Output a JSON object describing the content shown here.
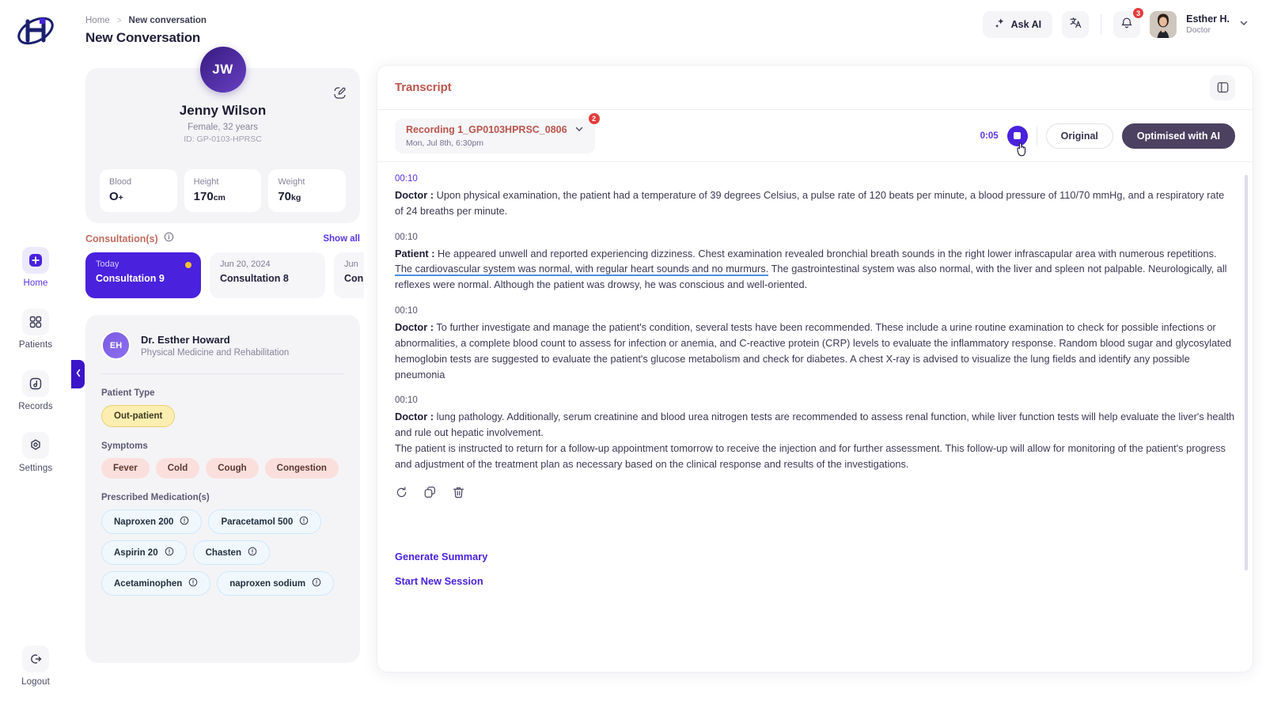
{
  "app": {
    "logo_alt": "H logo"
  },
  "breadcrumb": {
    "home": "Home",
    "separator": ">",
    "current": "New conversation"
  },
  "page_title": "New Conversation",
  "header": {
    "ask_ai": "Ask AI",
    "translate_icon": "translate-icon",
    "notification_count": "3",
    "user_name": "Esther H.",
    "user_role": "Doctor"
  },
  "sidebar": {
    "items": [
      {
        "label": "Home",
        "icon": "plus-square-icon",
        "active": true
      },
      {
        "label": "Patients",
        "icon": "grid-icon",
        "active": false
      },
      {
        "label": "Records",
        "icon": "note-icon",
        "active": false
      },
      {
        "label": "Settings",
        "icon": "gear-hex-icon",
        "active": false
      }
    ],
    "logout": "Logout"
  },
  "patient": {
    "initials": "JW",
    "name": "Jenny Wilson",
    "sub": "Female, 32 years",
    "id": "ID: GP-0103-HPRSC",
    "vitals": [
      {
        "key": "Blood",
        "value": "O",
        "unit": "+"
      },
      {
        "key": "Height",
        "value": "170",
        "unit": "cm"
      },
      {
        "key": "Weight",
        "value": "70",
        "unit": "kg"
      }
    ]
  },
  "consultations": {
    "title": "Consultation(s)",
    "show_all": "Show all",
    "cards": [
      {
        "date": "Today",
        "name": "Consultation 9",
        "selected": true
      },
      {
        "date": "Jun 20, 2024",
        "name": "Consultation 8",
        "selected": false
      },
      {
        "date": "Jun",
        "name": "Con",
        "selected": false
      }
    ]
  },
  "doctor": {
    "initials": "EH",
    "name": "Dr. Esther Howard",
    "specialty": "Physical Medicine and Rehabilitation"
  },
  "patient_type": {
    "label": "Patient Type",
    "value": "Out-patient"
  },
  "symptoms": {
    "label": "Symptoms",
    "items": [
      "Fever",
      "Cold",
      "Cough",
      "Congestion"
    ]
  },
  "medications": {
    "label": "Prescribed Medication(s)",
    "items": [
      "Naproxen 200",
      "Paracetamol 500",
      "Aspirin 20",
      "Chasten",
      "Acetaminophen",
      "naproxen sodium"
    ]
  },
  "transcript": {
    "title": "Transcript",
    "panel_toggle_icon": "panel-layout-icon",
    "recording_name": "Recording 1_GP0103HPRSC_0806",
    "recording_date": "Mon, Jul 8th, 6:30pm",
    "recording_badge": "2",
    "timecode": "0:05",
    "stop_icon": "stop-icon",
    "view_original": "Original",
    "view_optimised": "Optimised with AI",
    "active_view": "Optimised with AI",
    "entries": [
      {
        "time": "00:10",
        "speaker": "Doctor :",
        "text": "Upon physical examination, the patient had a temperature of 39 degrees Celsius, a pulse rate of 120 beats per minute, a blood pressure of 110/70 mmHg, and a respiratory rate of 24 breaths per minute."
      },
      {
        "time": "00:10",
        "speaker": "Patient :",
        "text_before": "He appeared unwell and reported experiencing dizziness. Chest examination revealed bronchial breath sounds in the right lower infrascapular area with numerous repetitions. ",
        "text_underlined": "The cardiovascular system was normal, with regular heart sounds and no murmurs.",
        "text_after": " The gastrointestinal system was also normal, with the liver and spleen not palpable. Neurologically, all reflexes were normal. Although the patient was drowsy, he was conscious and well-oriented."
      },
      {
        "time": "00:10",
        "speaker": "Doctor :",
        "text": "To further investigate and manage the patient's condition, several tests have been recommended. These include a urine routine examination to check for possible infections or abnormalities, a complete blood count to assess for infection or anemia, and C-reactive protein (CRP) levels to evaluate the inflammatory response. Random blood sugar and glycosylated hemoglobin tests are suggested to evaluate the patient's glucose metabolism and check for diabetes. A chest X-ray is advised to visualize the lung fields and identify any possible pneumonia"
      },
      {
        "time": "00:10",
        "speaker": "Doctor :",
        "text": "lung pathology. Additionally, serum creatinine and blood urea nitrogen tests are recommended to assess renal function, while liver function tests will help evaluate the liver's health and rule out hepatic involvement.",
        "text2": "The patient is instructed to return for a follow-up appointment tomorrow to receive the injection and for further assessment. This follow-up will allow for monitoring of the patient's progress and adjustment of the treatment plan as necessary based on the clinical response and results of the investigations."
      }
    ],
    "tools": [
      "regenerate-icon",
      "copy-icon",
      "delete-icon"
    ],
    "generate_summary": "Generate Summary",
    "start_new_session": "Start New Session"
  },
  "colors": {
    "accent_purple": "#4a21dd",
    "accent_link": "#5b34e0",
    "title_red": "#b9554a",
    "badge_red": "#e23d3d",
    "chip_yellow": "#fceeb0",
    "chip_pink": "#fbdfdc",
    "chip_blue": "#f0f8fe",
    "dot_yellow": "#f2c230"
  }
}
